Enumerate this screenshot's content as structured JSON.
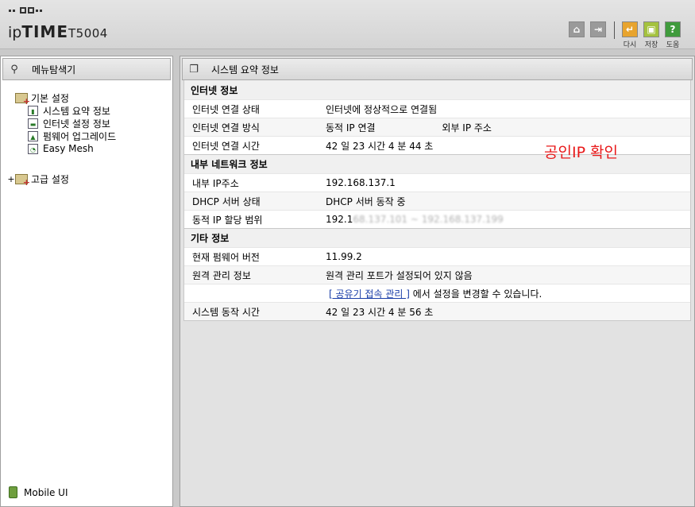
{
  "brand": {
    "name_prefix": "ip",
    "name_bold": "TIME",
    "model": "T5004"
  },
  "toolbar": {
    "buttons": [
      {
        "icon": "home-icon",
        "label": ""
      },
      {
        "icon": "logout-icon",
        "label": ""
      },
      {
        "icon": "refresh-icon",
        "label": "다시"
      },
      {
        "icon": "save-icon",
        "label": "저장"
      },
      {
        "icon": "help-icon",
        "label": "도움"
      }
    ]
  },
  "sidebar": {
    "title": "메뉴탐색기",
    "groups": [
      {
        "label": "기본 설정",
        "items": [
          "시스템 요약 정보",
          "인터넷 설정 정보",
          "펌웨어 업그레이드",
          "Easy Mesh"
        ]
      },
      {
        "label": "고급 설정",
        "items": []
      }
    ],
    "footer": "Mobile UI"
  },
  "main": {
    "title": "시스템 요약 정보",
    "annotation": "공인IP 확인",
    "sections": [
      {
        "title": "인터넷 정보",
        "rows": [
          {
            "label": "인터넷 연결 상태",
            "value": "인터넷에 정상적으로 연결됨"
          },
          {
            "label": "인터넷 연결 방식",
            "value": "동적 IP 연결",
            "extra": "외부 IP 주소"
          },
          {
            "label": "인터넷 연결 시간",
            "value": "42 일 23 시간 4 분 44 초"
          }
        ]
      },
      {
        "title": "내부 네트워크 정보",
        "rows": [
          {
            "label": "내부 IP주소",
            "value": "192.168.137.1"
          },
          {
            "label": "DHCP 서버 상태",
            "value": "DHCP 서버 동작 중"
          },
          {
            "label": "동적 IP 할당 범위",
            "value": "192.1",
            "value_blurred": "68.137.101 ~ 192.168.137.199"
          }
        ]
      },
      {
        "title": "기타 정보",
        "rows": [
          {
            "label": "현재 펌웨어 버전",
            "value": "11.99.2"
          },
          {
            "label": "원격 관리 정보",
            "value": "원격 관리 포트가 설정되어 있지 않음"
          },
          {
            "label": "",
            "link": "[ 공유기 접속 관리 ]",
            "value": " 에서 설정을 변경할 수 있습니다."
          },
          {
            "label": "시스템 동작 시간",
            "value": "42 일 23 시간 4 분 56 초"
          }
        ]
      }
    ]
  }
}
